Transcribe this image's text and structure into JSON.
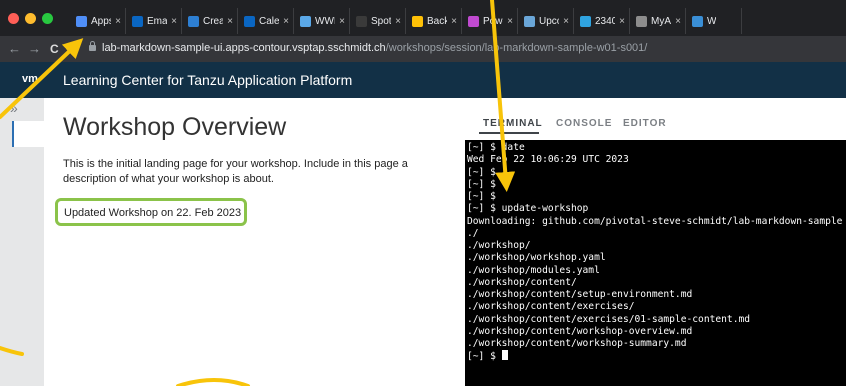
{
  "browser": {
    "traffic_lights": [
      "#ff5f57",
      "#febc2e",
      "#28c840"
    ],
    "tabs": [
      {
        "label": "Apps",
        "favicon_color": "#4f8ef7"
      },
      {
        "label": "Emai",
        "favicon_color": "#0a66c2"
      },
      {
        "label": "Creat",
        "favicon_color": "#2d7fd3"
      },
      {
        "label": "Caler",
        "favicon_color": "#0a66c2"
      },
      {
        "label": "WWI",
        "favicon_color": "#5aa8e8"
      },
      {
        "label": "Spot",
        "favicon_color": "#3a3a3a"
      },
      {
        "label": "Back",
        "favicon_color": "#ffc107"
      },
      {
        "label": "Powe",
        "favicon_color": "#c04ad0"
      },
      {
        "label": "Upco",
        "favicon_color": "#6aa6d8"
      },
      {
        "label": "2340",
        "favicon_color": "#2fa3e0"
      },
      {
        "label": "MyAI",
        "favicon_color": "#8d8d8d"
      },
      {
        "label": "W",
        "favicon_color": "#3a8fd6"
      }
    ],
    "tab_close_glyph": "×",
    "nav": {
      "back": "←",
      "forward": "→",
      "reload": "C"
    },
    "url": {
      "host": "lab-markdown-sample-ui.apps-contour.vsptap.sschmidt.ch",
      "path": "/workshops/session/lab-markdown-sample-w01-s001/"
    }
  },
  "app": {
    "logo": "vm",
    "title": "Learning Center for Tanzu Application Platform",
    "sidebar_toggle": "»"
  },
  "content": {
    "heading": "Workshop Overview",
    "intro": "This is the initial landing page for your workshop. Include in this page a description of what your workshop is about.",
    "updated": "Updated Workshop on 22. Feb 2023"
  },
  "workshop_tabs": [
    "TERMINAL",
    "CONSOLE",
    "EDITOR"
  ],
  "terminal_lines": [
    "[~] $ date",
    "Wed Feb 22 10:06:29 UTC 2023",
    "[~] $",
    "[~] $",
    "[~] $",
    "[~] $ update-workshop",
    "Downloading: github.com/pivotal-steve-schmidt/lab-markdown-sample",
    "./",
    "./workshop/",
    "./workshop/workshop.yaml",
    "./workshop/modules.yaml",
    "./workshop/content/",
    "./workshop/content/setup-environment.md",
    "./workshop/content/exercises/",
    "./workshop/content/exercises/01-sample-content.md",
    "./workshop/content/workshop-overview.md",
    "./workshop/content/workshop-summary.md"
  ],
  "terminal_prompt": "[~] $ ",
  "colors": {
    "annotation": "#f8c40a",
    "highlight_box": "#8bc34a",
    "app_header": "#123046"
  }
}
